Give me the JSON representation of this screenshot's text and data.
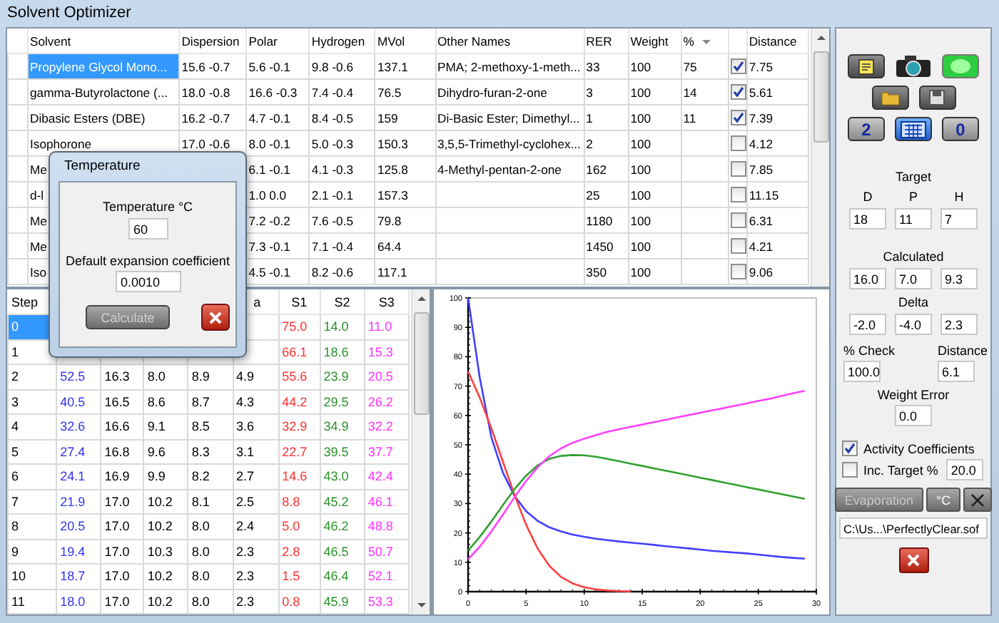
{
  "window": {
    "title": "Solvent Optimizer"
  },
  "solvents_table": {
    "columns": [
      {
        "label": "Solvent",
        "sorted": false
      },
      {
        "label": "Dispersion",
        "sorted": false
      },
      {
        "label": "Polar",
        "sorted": false
      },
      {
        "label": "Hydrogen",
        "sorted": false
      },
      {
        "label": "MVol",
        "sorted": false
      },
      {
        "label": "Other Names",
        "sorted": false
      },
      {
        "label": "RER",
        "sorted": false
      },
      {
        "label": "Weight",
        "sorted": false
      },
      {
        "label": "%",
        "sorted": true
      },
      {
        "label": "Distance",
        "sorted": false
      }
    ],
    "rows": [
      {
        "solvent": "Propylene Glycol Mono...",
        "selected": true,
        "dispersion": "15.6 -0.7",
        "polar": "5.6 -0.1",
        "hydrogen": "9.8 -0.6",
        "mvol": "137.1",
        "other_names": "PMA; 2-methoxy-1-meth...",
        "rer": "33",
        "weight": "100",
        "percent": "75",
        "checked": true,
        "distance": "7.75"
      },
      {
        "solvent": "gamma-Butyrolactone (...",
        "selected": false,
        "dispersion": "18.0 -0.8",
        "polar": "16.6 -0.3",
        "hydrogen": "7.4 -0.4",
        "mvol": "76.5",
        "other_names": "Dihydro-furan-2-one",
        "rer": "3",
        "weight": "100",
        "percent": "14",
        "checked": true,
        "distance": "5.61"
      },
      {
        "solvent": "Dibasic Esters (DBE)",
        "selected": false,
        "dispersion": "16.2 -0.7",
        "polar": "4.7 -0.1",
        "hydrogen": "8.4 -0.5",
        "mvol": "159",
        "other_names": "Di-Basic Ester; Dimethyl...",
        "rer": "1",
        "weight": "100",
        "percent": "11",
        "checked": true,
        "distance": "7.39"
      },
      {
        "solvent": "Isophorone",
        "selected": false,
        "dispersion": "17.0 -0.6",
        "polar": "8.0 -0.1",
        "hydrogen": "5.0 -0.3",
        "mvol": "150.3",
        "other_names": "3,5,5-Trimethyl-cyclohex...",
        "rer": "2",
        "weight": "100",
        "checked": false,
        "distance": "4.12"
      },
      {
        "solvent": "Me",
        "selected": false,
        "polar": "6.1 -0.1",
        "hydrogen": "4.1 -0.3",
        "mvol": "125.8",
        "other_names": "4-Methyl-pentan-2-one",
        "rer": "162",
        "weight": "100",
        "checked": false,
        "distance": "7.85"
      },
      {
        "solvent": "d-l",
        "selected": false,
        "polar": "1.0 0.0",
        "hydrogen": "2.1 -0.1",
        "mvol": "157.3",
        "rer": "25",
        "weight": "100",
        "checked": false,
        "distance": "11.15"
      },
      {
        "solvent": "Me",
        "selected": false,
        "polar": "7.2 -0.2",
        "hydrogen": "7.6 -0.5",
        "mvol": "79.8",
        "rer": "1180",
        "weight": "100",
        "checked": false,
        "distance": "6.31"
      },
      {
        "solvent": "Me",
        "selected": false,
        "polar": "7.3 -0.1",
        "hydrogen": "7.1 -0.4",
        "mvol": "64.4",
        "rer": "1450",
        "weight": "100",
        "checked": false,
        "distance": "4.21"
      },
      {
        "solvent": "Iso",
        "selected": false,
        "polar": "4.5 -0.1",
        "hydrogen": "8.2 -0.6",
        "mvol": "117.1",
        "rer": "350",
        "weight": "100",
        "checked": false,
        "distance": "9.06"
      }
    ]
  },
  "steps_table": {
    "columns": {
      "step": "Step",
      "column_6": "a",
      "s1": "S1",
      "s2": "S2",
      "s3": "S3"
    },
    "rows": [
      {
        "step": "0",
        "selected": true,
        "s1": "75.0",
        "s2": "14.0",
        "s3": "11.0"
      },
      {
        "step": "1",
        "selected": false,
        "s1": "66.1",
        "s2": "18.6",
        "s3": "15.3"
      },
      {
        "step": "2",
        "selected": false,
        "cells": [
          "52.5",
          "16.3",
          "8.0",
          "8.9",
          "4.9"
        ],
        "s1": "55.6",
        "s2": "23.9",
        "s3": "20.5"
      },
      {
        "step": "3",
        "selected": false,
        "cells": [
          "40.5",
          "16.5",
          "8.6",
          "8.7",
          "4.3"
        ],
        "s1": "44.2",
        "s2": "29.5",
        "s3": "26.2"
      },
      {
        "step": "4",
        "selected": false,
        "cells": [
          "32.6",
          "16.6",
          "9.1",
          "8.5",
          "3.6"
        ],
        "s1": "32.9",
        "s2": "34.9",
        "s3": "32.2"
      },
      {
        "step": "5",
        "selected": false,
        "cells": [
          "27.4",
          "16.8",
          "9.6",
          "8.3",
          "3.1"
        ],
        "s1": "22.7",
        "s2": "39.5",
        "s3": "37.7"
      },
      {
        "step": "6",
        "selected": false,
        "cells": [
          "24.1",
          "16.9",
          "9.9",
          "8.2",
          "2.7"
        ],
        "s1": "14.6",
        "s2": "43.0",
        "s3": "42.4"
      },
      {
        "step": "7",
        "selected": false,
        "cells": [
          "21.9",
          "17.0",
          "10.2",
          "8.1",
          "2.5"
        ],
        "s1": "8.8",
        "s2": "45.2",
        "s3": "46.1"
      },
      {
        "step": "8",
        "selected": false,
        "cells": [
          "20.5",
          "17.0",
          "10.2",
          "8.0",
          "2.4"
        ],
        "s1": "5.0",
        "s2": "46.2",
        "s3": "48.8"
      },
      {
        "step": "9",
        "selected": false,
        "cells": [
          "19.4",
          "17.0",
          "10.3",
          "8.0",
          "2.3"
        ],
        "s1": "2.8",
        "s2": "46.5",
        "s3": "50.7"
      },
      {
        "step": "10",
        "selected": false,
        "cells": [
          "18.7",
          "17.0",
          "10.2",
          "8.0",
          "2.3"
        ],
        "s1": "1.5",
        "s2": "46.4",
        "s3": "52.1"
      },
      {
        "step": "11",
        "selected": false,
        "cells": [
          "18.0",
          "17.0",
          "10.2",
          "8.0",
          "2.3"
        ],
        "s1": "0.8",
        "s2": "45.9",
        "s3": "53.3"
      }
    ]
  },
  "evaporation_chart": {
    "chart_data": {
      "type": "line",
      "x": [
        0,
        1,
        2,
        3,
        4,
        5,
        6,
        7,
        8,
        9,
        10,
        11,
        12,
        13,
        14,
        15,
        16,
        17,
        18,
        19,
        20,
        21,
        22,
        23,
        24,
        25,
        26,
        27,
        28,
        29
      ],
      "xlim": [
        0,
        30
      ],
      "ylim": [
        0,
        100
      ],
      "xticks": [
        0,
        5,
        10,
        15,
        20,
        25,
        30
      ],
      "yticks": [
        0,
        10,
        20,
        30,
        40,
        50,
        60,
        70,
        80,
        90,
        100
      ],
      "series": [
        {
          "color": "#4040ff",
          "values": [
            100,
            73,
            52.5,
            40.5,
            32.6,
            27.4,
            24.1,
            21.9,
            20.5,
            19.4,
            18.7,
            18.0,
            17.5,
            17.1,
            16.7,
            16.3,
            15.9,
            15.5,
            15.1,
            14.7,
            14.3,
            13.9,
            13.6,
            13.3,
            13.0,
            12.6,
            12.2,
            11.8,
            11.5,
            11.2
          ]
        },
        {
          "color": "#ff4040",
          "values": [
            75.0,
            66.1,
            55.6,
            44.2,
            32.9,
            22.7,
            14.6,
            8.8,
            5.0,
            2.8,
            1.5,
            0.8,
            0.4,
            0.2,
            0.1,
            null,
            null,
            null,
            null,
            null,
            null,
            null,
            null,
            null,
            null,
            null,
            null,
            null,
            null,
            null
          ]
        },
        {
          "color": "#30a030",
          "values": [
            14.0,
            18.6,
            23.9,
            29.5,
            34.9,
            39.5,
            43.0,
            45.2,
            46.2,
            46.5,
            46.4,
            45.9,
            45.2,
            44.4,
            43.6,
            42.8,
            42.0,
            41.2,
            40.4,
            39.6,
            38.8,
            38.0,
            37.2,
            36.4,
            35.6,
            34.8,
            34.0,
            33.2,
            32.4,
            31.6
          ]
        },
        {
          "color": "#ff40ff",
          "values": [
            11.0,
            15.3,
            20.5,
            26.2,
            32.2,
            37.7,
            42.4,
            46.1,
            48.8,
            50.7,
            52.1,
            53.3,
            54.4,
            55.3,
            56.1,
            56.9,
            57.7,
            58.5,
            59.3,
            60.1,
            60.9,
            61.7,
            62.5,
            63.3,
            64.1,
            64.9,
            65.7,
            66.6,
            67.5,
            68.4
          ]
        }
      ]
    }
  },
  "side_panel": {
    "indicator": {
      "on": true
    },
    "left_number": "2",
    "right_number": "0",
    "target": {
      "title": "Target",
      "labels": [
        "D",
        "P",
        "H"
      ],
      "values": [
        "18",
        "11",
        "7"
      ]
    },
    "calculated": {
      "title": "Calculated",
      "values": [
        "16.0",
        "7.0",
        "9.3"
      ]
    },
    "delta": {
      "title": "Delta",
      "values": [
        "-2.0",
        "-4.0",
        "2.3"
      ]
    },
    "check": {
      "label": "% Check",
      "value": "100.0"
    },
    "distance": {
      "label": "Distance",
      "value": "6.1"
    },
    "weight_error": {
      "label": "Weight Error",
      "value": "0.0"
    },
    "options": [
      {
        "label": "Activity Coefficients",
        "checked": true
      },
      {
        "label": "Inc. Target %",
        "checked": false,
        "value": "20.0"
      }
    ],
    "buttons": [
      {
        "label": "Evaporation",
        "disabled": true
      },
      {
        "label": "°C",
        "disabled": false
      }
    ],
    "file_path": "C:\\Us...\\PerfectlyClear.sof"
  },
  "temperature_dialog": {
    "title": "Temperature",
    "temperature_label": "Temperature °C",
    "temperature": "60",
    "coefficient_label": "Default expansion coefficient",
    "coefficient": "0.0010",
    "calculate": {
      "label": "Calculate",
      "disabled": true
    }
  }
}
